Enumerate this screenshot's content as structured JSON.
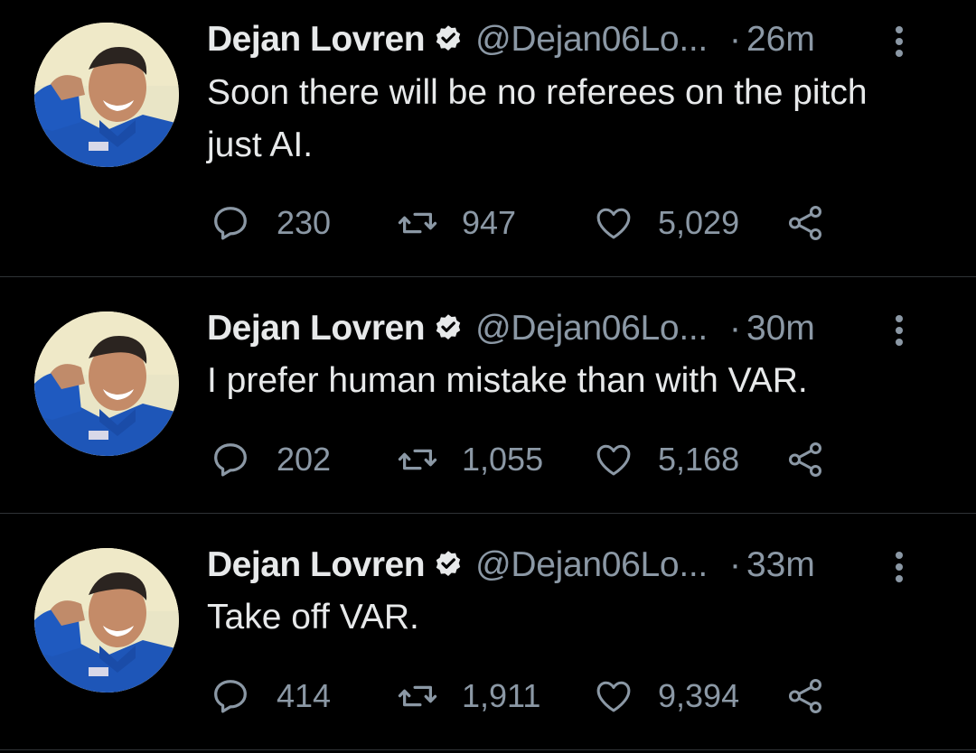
{
  "colors": {
    "background": "#000000",
    "primary_text": "#e7e9ea",
    "secondary_text": "#8b98a5",
    "divider": "#2f3336",
    "verified_badge": "#e7e9ea"
  },
  "icons": {
    "reply": "reply-icon",
    "retweet": "retweet-icon",
    "like": "heart-icon",
    "share": "share-icon",
    "more": "more-options-icon",
    "verified": "verified-badge-icon"
  },
  "tweets": [
    {
      "display_name": "Dejan Lovren",
      "handle": "@Dejan06Lo...",
      "separator": "·",
      "time": "26m",
      "text": "Soon there will be no referees on the pitch just AI.",
      "replies": "230",
      "retweets": "947",
      "likes": "5,029"
    },
    {
      "display_name": "Dejan Lovren",
      "handle": "@Dejan06Lo...",
      "separator": "·",
      "time": "30m",
      "text": "I prefer human mistake than with VAR.",
      "replies": "202",
      "retweets": "1,055",
      "likes": "5,168"
    },
    {
      "display_name": "Dejan Lovren",
      "handle": "@Dejan06Lo...",
      "separator": "·",
      "time": "33m",
      "text": "Take off VAR.",
      "replies": "414",
      "retweets": "1,911",
      "likes": "9,394"
    }
  ]
}
